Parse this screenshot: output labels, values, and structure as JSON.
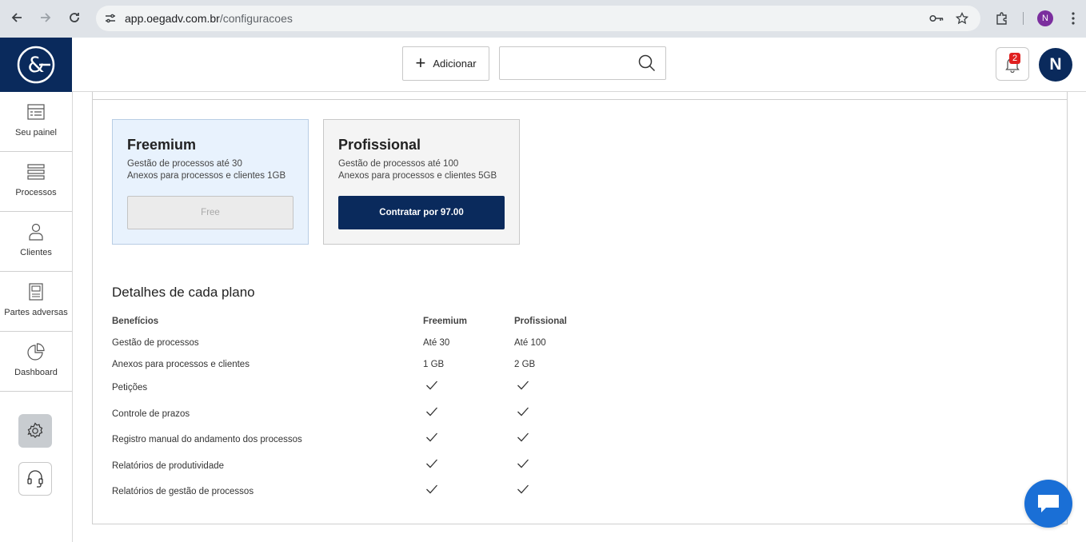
{
  "browser": {
    "url_domain": "app.oegadv.com.br",
    "url_path": "/configuracoes",
    "profile_initial": "N"
  },
  "header": {
    "add_label": "Adicionar",
    "search_value": "",
    "notification_count": "2",
    "avatar_initial": "N"
  },
  "sidebar": {
    "items": [
      {
        "label": "Seu painel",
        "icon": "dashboard-list-icon"
      },
      {
        "label": "Processos",
        "icon": "stack-icon"
      },
      {
        "label": "Clientes",
        "icon": "person-icon"
      },
      {
        "label": "Partes adversas",
        "icon": "document-icon"
      },
      {
        "label": "Dashboard",
        "icon": "pie-chart-icon"
      }
    ]
  },
  "plans": [
    {
      "name": "Freemium",
      "line1": "Gestão de processos até 30",
      "line2": "Anexos para processos e clientes 1GB",
      "button": "Free"
    },
    {
      "name": "Profissional",
      "line1": "Gestão de processos até 100",
      "line2": "Anexos para processos e clientes 5GB",
      "button": "Contratar por 97.00"
    }
  ],
  "details": {
    "title": "Detalhes de cada plano",
    "headers": [
      "Benefícios",
      "Freemium",
      "Profissional"
    ],
    "rows": [
      {
        "benefit": "Gestão de processos",
        "freemium": "Até 30",
        "profissional": "Até 100"
      },
      {
        "benefit": "Anexos para processos e clientes",
        "freemium": "1 GB",
        "profissional": "2 GB"
      },
      {
        "benefit": "Petições",
        "freemium": "check",
        "profissional": "check"
      },
      {
        "benefit": "Controle de prazos",
        "freemium": "check",
        "profissional": "check"
      },
      {
        "benefit": "Registro manual do andamento dos processos",
        "freemium": "check",
        "profissional": "check"
      },
      {
        "benefit": "Relatórios de produtividade",
        "freemium": "check",
        "profissional": "check"
      },
      {
        "benefit": "Relatórios de gestão de processos",
        "freemium": "check",
        "profissional": "check"
      }
    ]
  },
  "colors": {
    "brand": "#0a2a5c",
    "free_card_bg": "#e8f2fd",
    "badge": "#e02020",
    "chat": "#1a6fd6"
  }
}
